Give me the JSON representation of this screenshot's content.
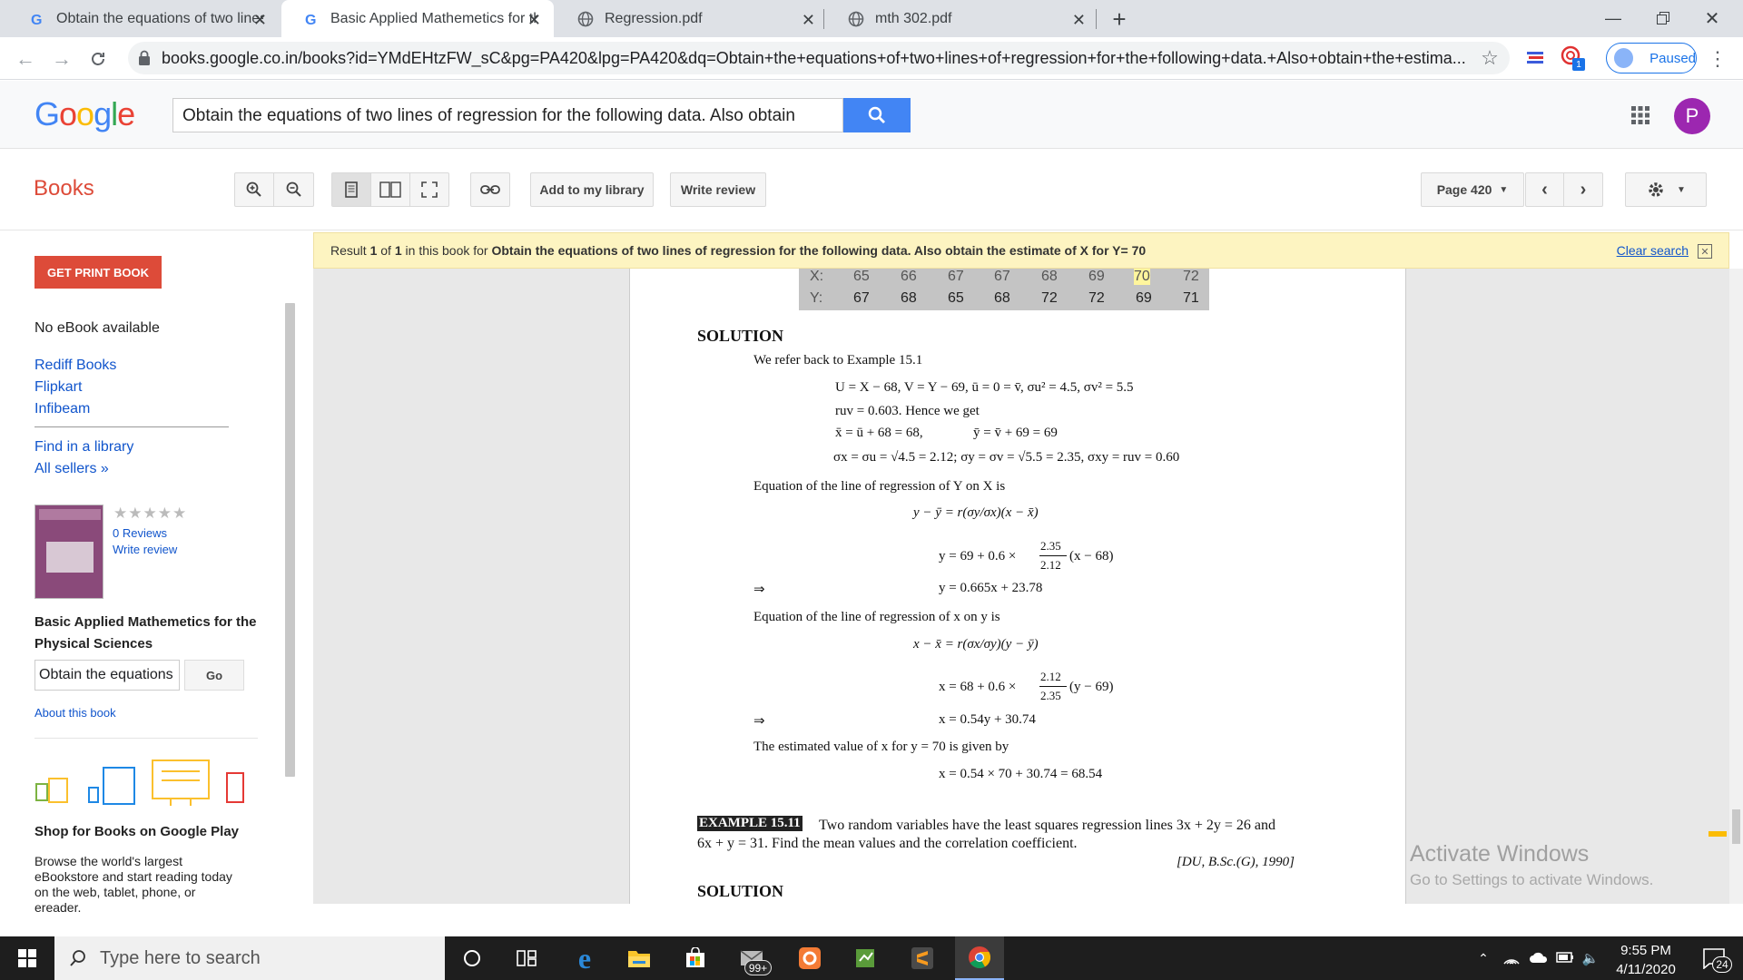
{
  "browser": {
    "tabs": [
      {
        "title": "Obtain the equations of two lines",
        "icon": "google-g-icon"
      },
      {
        "title": "Basic Applied Mathemetics for th",
        "icon": "google-g-icon",
        "active": true
      },
      {
        "title": "Regression.pdf",
        "icon": "globe-icon"
      },
      {
        "title": "mth 302.pdf",
        "icon": "globe-icon"
      }
    ],
    "url": "books.google.co.in/books?id=YMdEHtzFW_sC&pg=PA420&lpg=PA420&dq=Obtain+the+equations+of+two+lines+of+regression+for+the+following+data.+Also+obtain+the+estima...",
    "paused_label": "Paused",
    "extension_badge": "1"
  },
  "google": {
    "logo": "Google",
    "search_value": "Obtain the equations of two lines of regression for the following data. Also obtain",
    "avatar_letter": "P"
  },
  "books": {
    "label": "Books",
    "add_library": "Add to my library",
    "write_review": "Write review",
    "page_label": "Page 420"
  },
  "banner": {
    "prefix": "Result ",
    "n1": "1",
    "of": " of ",
    "n2": "1",
    "middle": " in this book for ",
    "query": "Obtain the equations of two lines of regression for the following data. Also obtain the estimate of X for Y= 70",
    "clear": "Clear search"
  },
  "sidebar": {
    "print_button": "GET PRINT BOOK",
    "no_ebook": "No eBook available",
    "sellers": [
      "Rediff Books",
      "Flipkart",
      "Infibeam"
    ],
    "find_library": "Find in a library",
    "all_sellers": "All sellers »",
    "reviews": "0 Reviews",
    "write_review": "Write review",
    "book_title_line1": "Basic Applied Mathemetics for the",
    "book_title_line2": "Physical Sciences",
    "search_value": "Obtain the equations",
    "go": "Go",
    "about": "About this book",
    "shop_title": "Shop for Books on Google Play",
    "shop_text": [
      "Browse the world's largest",
      "eBookstore and start reading today",
      "on the web, tablet, phone, or",
      "ereader."
    ]
  },
  "page": {
    "table_x": [
      "X:",
      "65",
      "66",
      "67",
      "67",
      "68",
      "69",
      "70",
      "72"
    ],
    "table_y": [
      "Y:",
      "67",
      "68",
      "65",
      "68",
      "72",
      "72",
      "69",
      "71"
    ],
    "solution": "SOLUTION",
    "refer": "We refer back to Example 15.1",
    "eq1": "U = X − 68,   V = Y − 69,   ū = 0 = v̄,   σu² = 4.5,   σv² = 5.5",
    "eq2": "ruv = 0.603. Hence we get",
    "eq3a": "x̄ = ū + 68 = 68,",
    "eq3b": "ȳ = v̄ + 69 = 69",
    "eq4": "σx = σu = √4.5 = 2.12;   σy = σv = √5.5 = 2.35,   σxy = ruv = 0.60",
    "line_yx": "Equation of the line of regression of Y on X is",
    "eq5": "y − ȳ = r(σy/σx)(x − x̄)",
    "eq6_pre": "y = 69 + 0.6 ×",
    "eq6_num": "2.35",
    "eq6_den": "2.12",
    "eq6_post": "(x − 68)",
    "implies": "⇒",
    "eq7": "y = 0.665x + 23.78",
    "line_xy": "Equation of the line of regression of x on y is",
    "eq8": "x − x̄ = r(σx/σy)(y − ȳ)",
    "eq9_pre": "x = 68 + 0.6 ×",
    "eq9_num": "2.12",
    "eq9_den": "2.35",
    "eq9_post": "(y − 69)",
    "eq10": "x = 0.54y + 30.74",
    "estimated": "The estimated value of x for y = 70 is given by",
    "eq11": "x = 0.54 × 70 + 30.74 = 68.54",
    "example_label": "EXAMPLE 15.11",
    "example_text1": " Two random variables have the least squares regression lines 3x + 2y = 26 and",
    "example_text2": "6x + y = 31. Find the mean values and the correlation coefficient.",
    "example_ref": "[DU, B.Sc.(G), 1990]",
    "solution2": "SOLUTION"
  },
  "windows_watermark": {
    "line1": "Activate Windows",
    "line2": "Go to Settings to activate Windows."
  },
  "taskbar": {
    "search_placeholder": "Type here to search",
    "mail_badge": "99+",
    "time": "9:55 PM",
    "date": "4/11/2020",
    "notification_count": "24"
  },
  "colors": {
    "books_red": "#dd4b39",
    "google_blue": "#4285f4",
    "highlight": "#fff59d",
    "banner_bg": "#fdf4c1"
  }
}
